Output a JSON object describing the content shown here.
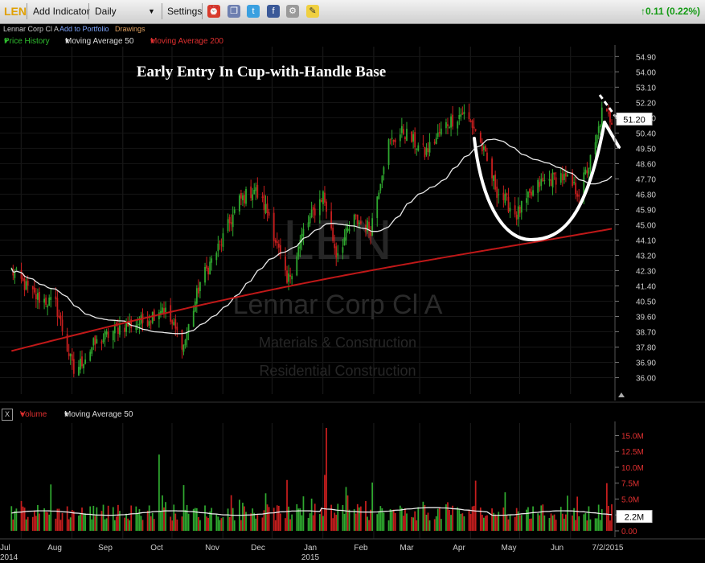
{
  "toolbar": {
    "symbol": "LEN",
    "add_indicator": "Add Indicator",
    "interval": "Daily",
    "settings": "Settings",
    "change": "0.11 (0.22%)"
  },
  "subbar": {
    "company": "Lennar Corp Cl A",
    "add_to_portfolio": "Add to Portfolio",
    "drawings": "Drawings"
  },
  "legend": {
    "price_history": "Price History",
    "ma50": "Moving Average 50",
    "ma200": "Moving Average 200",
    "volume": "Volume",
    "vol_ma50": "Moving Average 50",
    "close_button": "X"
  },
  "colors": {
    "up": "#2fa82f",
    "down": "#c81e1e",
    "ma50": "#e8e8e8",
    "ma200": "#c01818",
    "price_history_label": "#2fbf2f",
    "ma200_label": "#e03030",
    "volume_label": "#e03030"
  },
  "chart_data": {
    "type": "candlestick",
    "title": "Early Entry In Cup-with-Handle Base",
    "watermark": [
      "LEN",
      "Lennar Corp Cl A",
      "Materials & Construction",
      "Residential Construction"
    ],
    "x_labels": [
      {
        "month": "Jul",
        "year": "2014"
      },
      {
        "month": "Aug"
      },
      {
        "month": "Sep"
      },
      {
        "month": "Oct"
      },
      {
        "month": "Nov"
      },
      {
        "month": "Dec"
      },
      {
        "month": "Jan",
        "year": "2015"
      },
      {
        "month": "Feb"
      },
      {
        "month": "Mar"
      },
      {
        "month": "Apr"
      },
      {
        "month": "May"
      },
      {
        "month": "Jun"
      },
      {
        "month": "7/2/2015"
      }
    ],
    "price_axis": {
      "ticks": [
        "54.90",
        "54.00",
        "53.10",
        "52.20",
        "51.30",
        "50.40",
        "49.50",
        "48.60",
        "47.70",
        "46.80",
        "45.90",
        "45.00",
        "44.10",
        "43.20",
        "42.30",
        "41.40",
        "40.50",
        "39.60",
        "38.70",
        "37.80",
        "36.90",
        "36.00"
      ],
      "range": [
        35.6,
        55.2
      ]
    },
    "last_price": "51.20",
    "price_anchors": [
      [
        "2014-07-01",
        42.3
      ],
      [
        "2014-07-15",
        40.8
      ],
      [
        "2014-07-28",
        40.3
      ],
      [
        "2014-08-08",
        36.3
      ],
      [
        "2014-08-20",
        37.9
      ],
      [
        "2014-09-05",
        39.0
      ],
      [
        "2014-09-20",
        39.3
      ],
      [
        "2014-10-01",
        40.2
      ],
      [
        "2014-10-14",
        37.9
      ],
      [
        "2014-10-24",
        41.6
      ],
      [
        "2014-11-05",
        43.8
      ],
      [
        "2014-11-17",
        46.4
      ],
      [
        "2014-11-26",
        47.1
      ],
      [
        "2014-12-05",
        45.6
      ],
      [
        "2014-12-16",
        41.5
      ],
      [
        "2014-12-26",
        44.6
      ],
      [
        "2015-01-07",
        46.8
      ],
      [
        "2015-01-15",
        43.3
      ],
      [
        "2015-01-26",
        45.3
      ],
      [
        "2015-02-05",
        44.8
      ],
      [
        "2015-02-15",
        49.7
      ],
      [
        "2015-02-25",
        50.5
      ],
      [
        "2015-03-10",
        49.2
      ],
      [
        "2015-03-24",
        51.0
      ],
      [
        "2015-04-02",
        51.6
      ],
      [
        "2015-04-10",
        50.6
      ],
      [
        "2015-04-23",
        47.0
      ],
      [
        "2015-05-05",
        45.6
      ],
      [
        "2015-05-19",
        47.4
      ],
      [
        "2015-06-01",
        47.9
      ],
      [
        "2015-06-12",
        46.9
      ],
      [
        "2015-06-22",
        49.6
      ],
      [
        "2015-06-26",
        51.6
      ],
      [
        "2015-07-02",
        51.2
      ]
    ],
    "volume_axis": {
      "ticks": [
        "15.0M",
        "12.5M",
        "10.0M",
        "7.5M",
        "5.0M",
        "2.5M",
        "0.00"
      ],
      "range": [
        0,
        16.2
      ]
    },
    "last_volume": "2.2M",
    "volume_average_millions": 2.8,
    "volume_spikes_millions": [
      [
        "2014-07-25",
        7.3
      ],
      [
        "2014-09-29",
        12.0
      ],
      [
        "2014-10-14",
        7.2
      ],
      [
        "2014-12-16",
        8.0
      ],
      [
        "2015-01-08",
        8.8
      ],
      [
        "2015-01-09",
        16.2
      ],
      [
        "2015-01-10",
        9.4
      ],
      [
        "2015-01-21",
        6.9
      ],
      [
        "2015-02-06",
        7.6
      ],
      [
        "2015-04-10",
        7.9
      ],
      [
        "2015-06-29",
        7.5
      ]
    ],
    "annotations": [
      "cup-with-handle curve drawn in white",
      "dashed handle line"
    ]
  }
}
